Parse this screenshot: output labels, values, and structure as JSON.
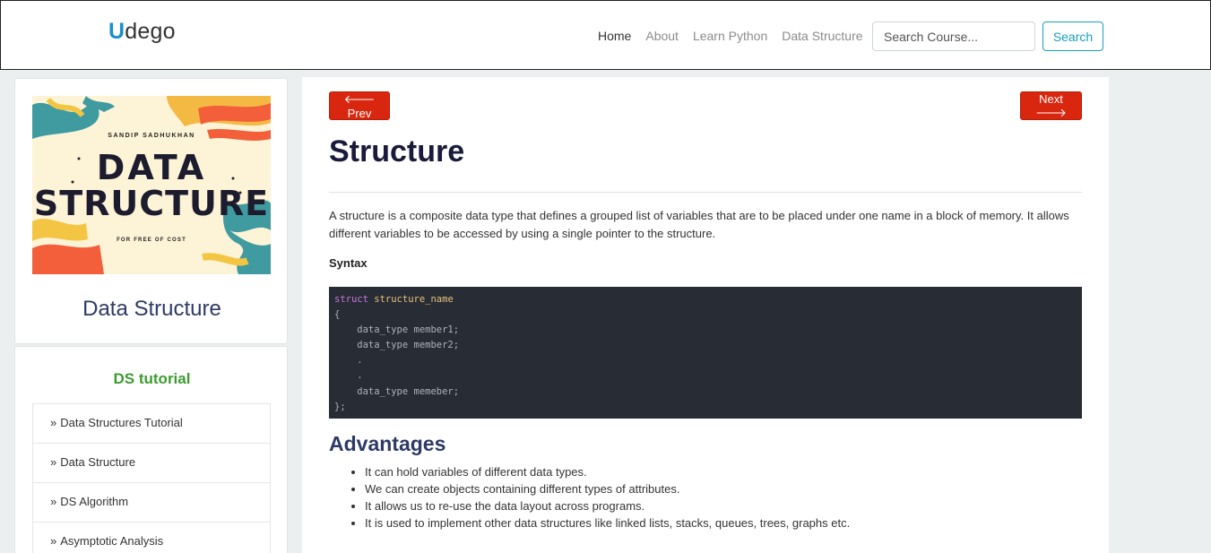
{
  "navbar": {
    "brand_first": "U",
    "brand_rest": "dego",
    "links": [
      "Home",
      "About",
      "Learn Python",
      "Data Structure"
    ],
    "search_placeholder": "Search Course...",
    "search_button": "Search"
  },
  "sidebar": {
    "cover": {
      "author": "SANDIP SADHUKHAN",
      "title_line1": "DATA",
      "title_line2": "STRUCTURE",
      "tagline": "FOR FREE OF COST"
    },
    "title": "Data Structure",
    "menu_heading": "DS tutorial",
    "menu_items": [
      "Data Structures Tutorial",
      "Data Structure",
      "DS Algorithm",
      "Asymptotic Analysis"
    ]
  },
  "main": {
    "prev_label": "Prev",
    "next_label": "Next",
    "title": "Structure",
    "intro": "A structure is a composite data type that defines a grouped list of variables that are to be placed under one name in a block of memory. It allows different variables to be accessed by using a single pointer to the structure.",
    "syntax_label": "Syntax",
    "code": {
      "keyword": "struct",
      "name": "structure_name",
      "body": "{\n    data_type member1;\n    data_type member2;\n    .\n    .\n    data_type memeber;\n};"
    },
    "advantages_title": "Advantages",
    "advantages": [
      "It can hold variables of different data types.",
      "We can create objects containing different types of attributes.",
      "It allows us to re-use the data layout across programs.",
      "It is used to implement other data structures like linked lists, stacks, queues, trees, graphs etc."
    ]
  },
  "colors": {
    "brand_accent": "#1a8fc9",
    "button_red": "#d9260f",
    "menu_heading_green": "#3d9b2f",
    "code_bg": "#282c34"
  }
}
